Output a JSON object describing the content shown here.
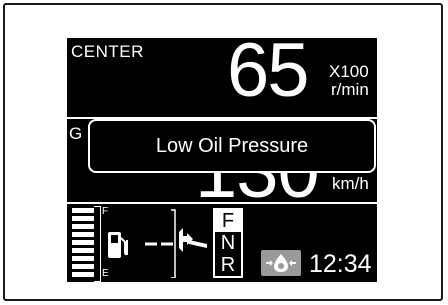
{
  "display": {
    "mode_label": "CENTER",
    "rpm": {
      "value": "65",
      "unit_multiplier": "X100",
      "unit": "r/min"
    },
    "speed": {
      "value": "130",
      "unit": "km/h"
    },
    "partial_label": "G",
    "popup": {
      "message": "Low Oil Pressure"
    },
    "fuel": {
      "full_label": "F",
      "empty_label": "E",
      "level_fraction": 1.0,
      "icon": "fuel-pump-icon"
    },
    "direction_icon": "travel-direction-icon",
    "gear": {
      "selected": "F",
      "options": [
        "F",
        "N",
        "R"
      ]
    },
    "warning_icon": "oil-pressure-warning-icon",
    "clock": "12:34",
    "colors": {
      "screen_bg": "#000000",
      "text": "#ffffff",
      "warning_bg": "#9a9a9a"
    }
  }
}
